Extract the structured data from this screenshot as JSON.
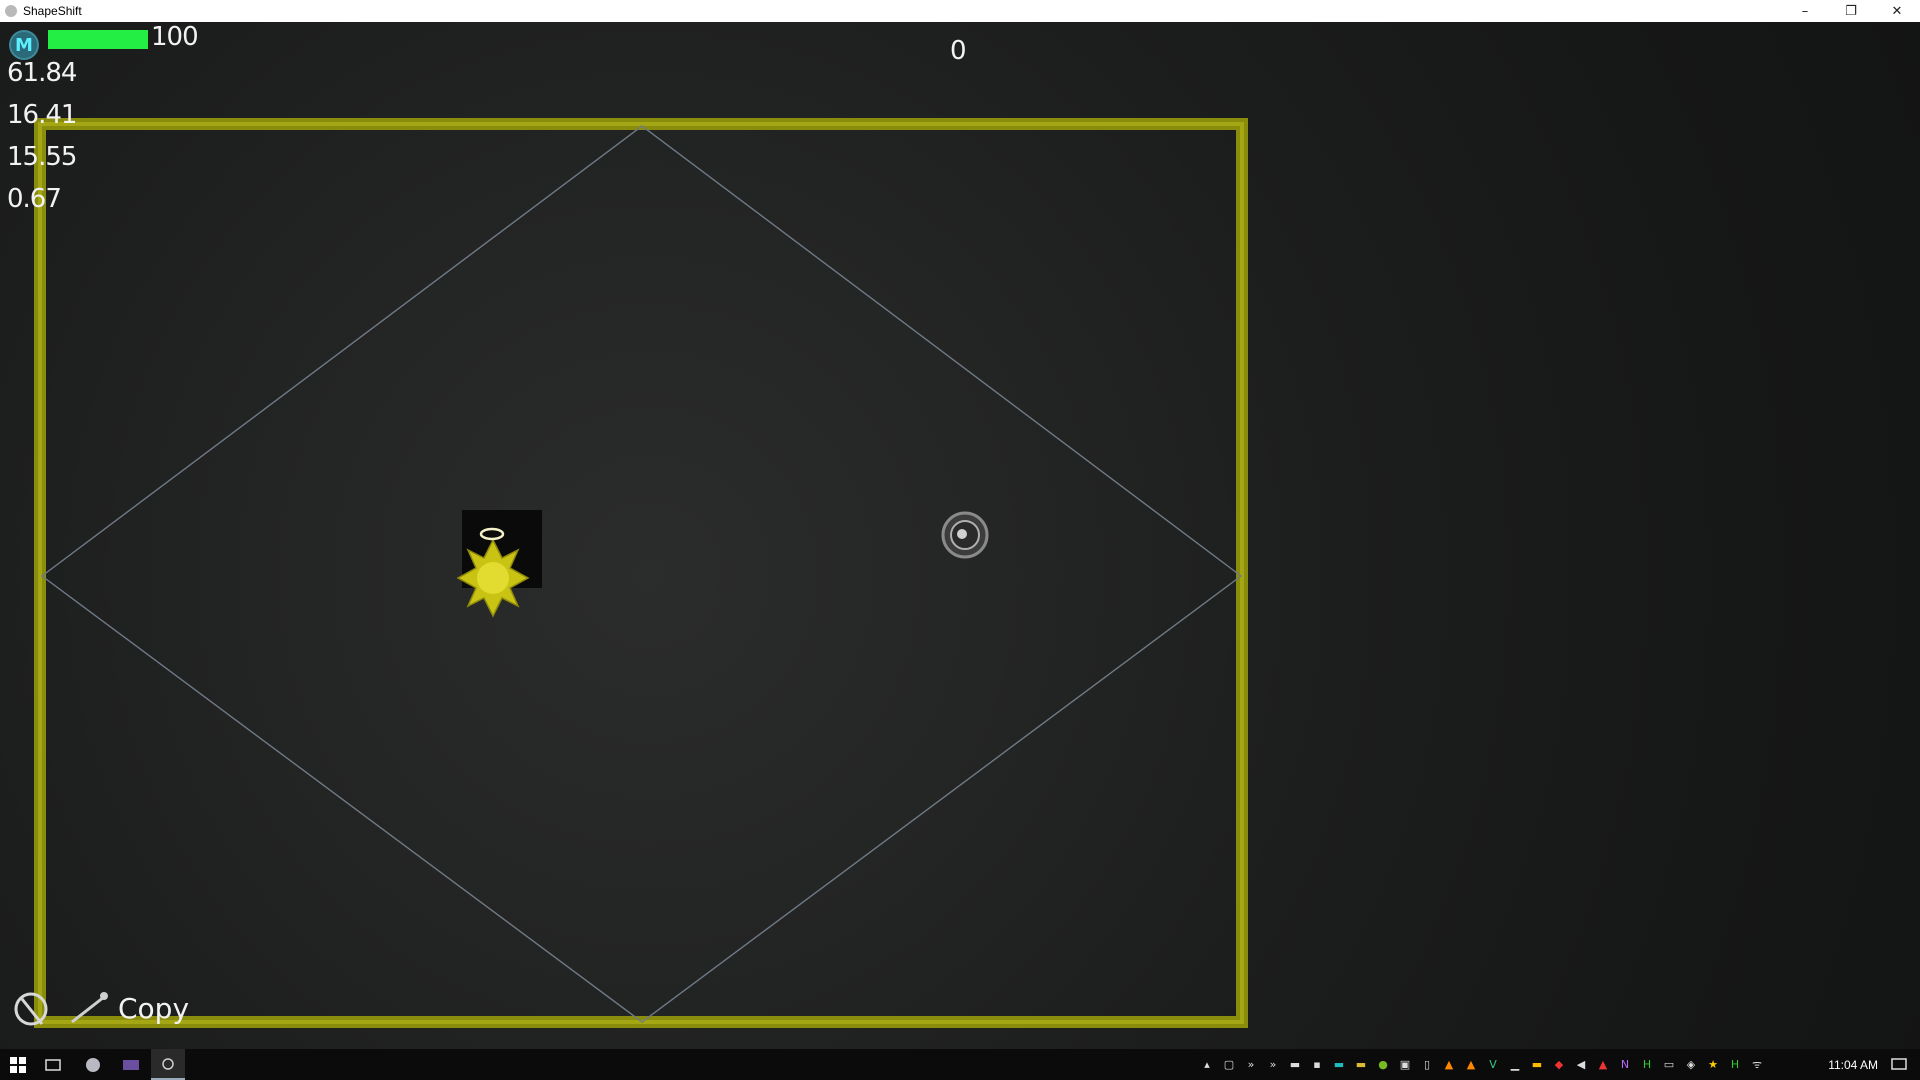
{
  "window": {
    "title": "ShapeShift",
    "minimize": "–",
    "restore": "❐",
    "close": "✕"
  },
  "hud": {
    "avatar_letter": "M",
    "health_value": "100",
    "health_fraction": 1.0,
    "score": "0",
    "stats": [
      "61.84",
      "16.41",
      "15.55",
      "0.67"
    ],
    "ability_label": "Copy"
  },
  "taskbar": {
    "time": "11:04 AM"
  },
  "colors": {
    "arena_border": "#9a9d10",
    "health": "#22ee44",
    "diamond_line": "#7a8590"
  }
}
